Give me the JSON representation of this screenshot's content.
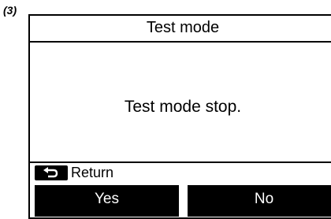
{
  "step": {
    "label": "(3)"
  },
  "screen": {
    "title": "Test mode",
    "message": "Test mode stop.",
    "return": {
      "icon": "return-arrow-icon",
      "label": "Return"
    },
    "buttons": {
      "yes": "Yes",
      "no": "No"
    }
  },
  "colors": {
    "foreground": "#000000",
    "background": "#ffffff",
    "button_text": "#ffffff"
  }
}
